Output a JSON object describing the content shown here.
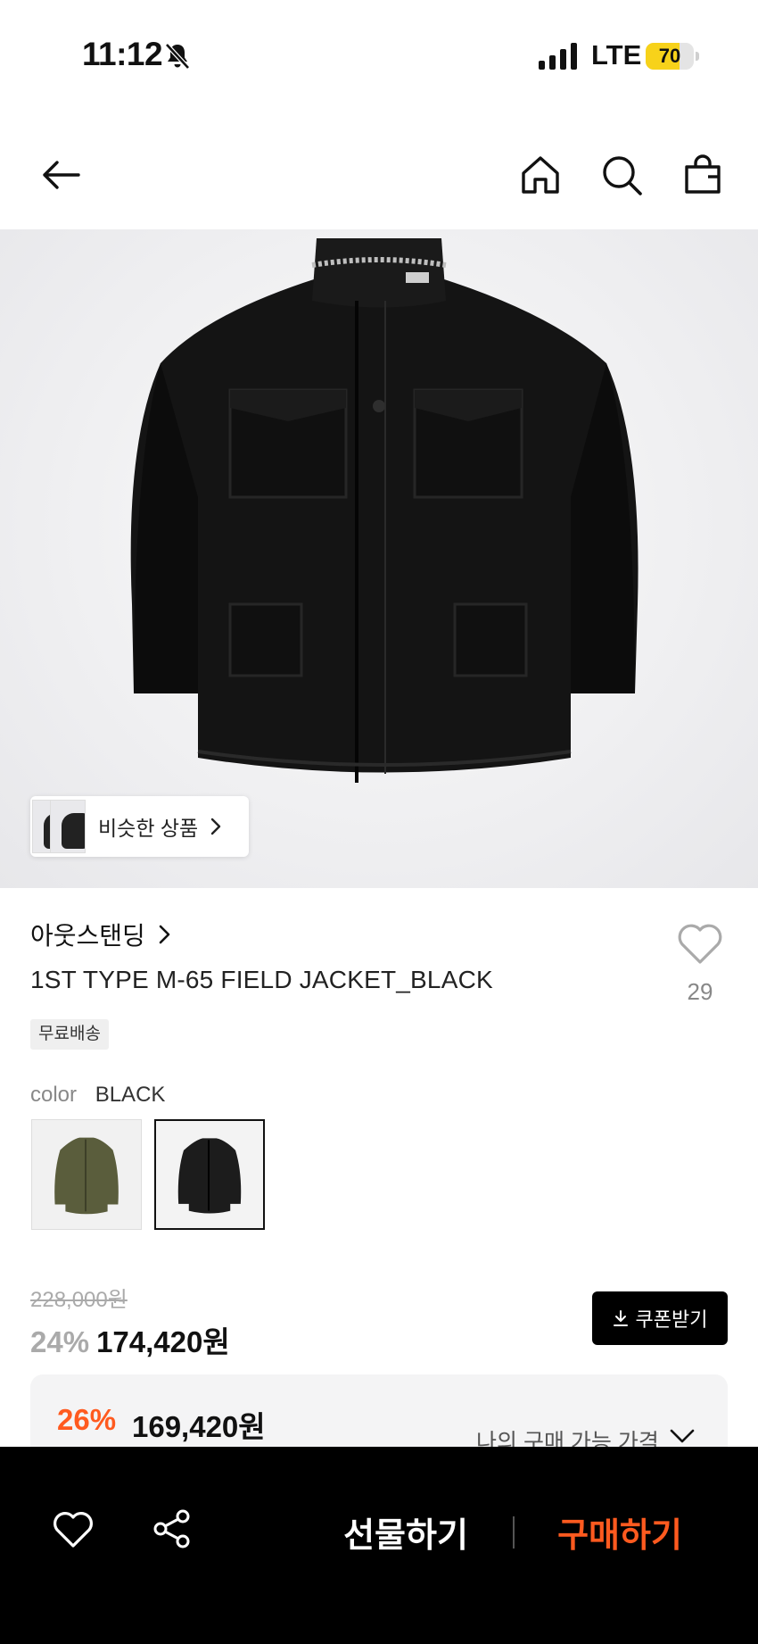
{
  "status_bar": {
    "time": "11:12",
    "network": "LTE",
    "battery_level": "70",
    "battery_fraction": 0.7,
    "battery_color": "#f7d21a"
  },
  "nav": {
    "icons": [
      "back-arrow-icon",
      "home-icon",
      "search-icon",
      "shopping-bag-icon"
    ]
  },
  "hero": {
    "similar_label": "비슷한 상품"
  },
  "product": {
    "brand": "아웃스탠딩",
    "title": "1ST TYPE M-65 FIELD JACKET_BLACK",
    "like_count": "29",
    "shipping_badge": "무료배송",
    "color_key": "color",
    "color_value": "BLACK",
    "swatches": [
      {
        "name": "olive",
        "color": "#5a5d3c",
        "selected": false
      },
      {
        "name": "black",
        "color": "#1c1c1c",
        "selected": true
      }
    ]
  },
  "price": {
    "original": "228,000원",
    "discount": "24%",
    "sale": "174,420원",
    "coupon_label": "쿠폰받기"
  },
  "member_price": {
    "discount": "26%",
    "price": "169,420원",
    "label": "나의 구매 가능 가격",
    "accent_color": "#ff5a1f"
  },
  "bottom_bar": {
    "gift_label": "선물하기",
    "buy_label": "구매하기",
    "buy_color": "#ff5a1f"
  }
}
